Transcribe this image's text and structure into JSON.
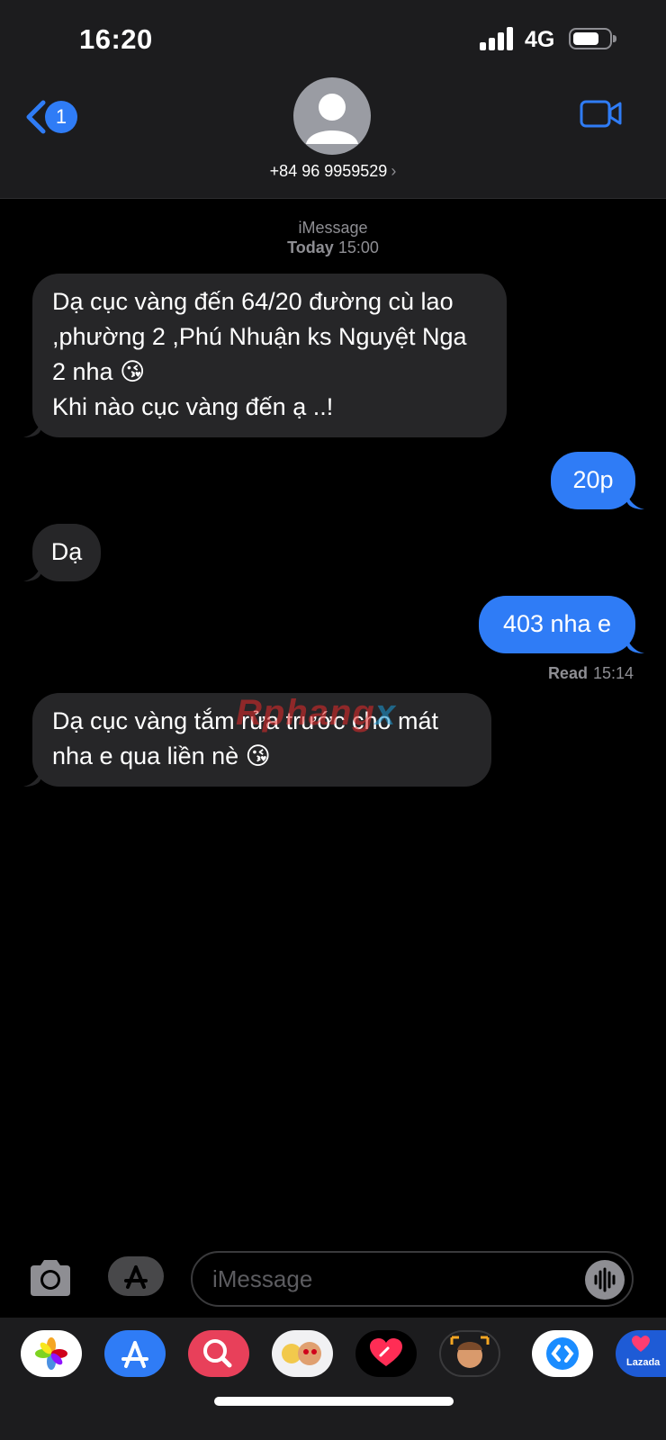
{
  "status_bar": {
    "time": "16:20",
    "network": "4G"
  },
  "header": {
    "unread_count": "1",
    "contact_name": "+84 96 9959529",
    "arrow": "›"
  },
  "conversation": {
    "service": "iMessage",
    "timestamp_label": "Today",
    "timestamp_time": "15:00",
    "messages": [
      {
        "direction": "in",
        "text": "Dạ cục vàng đến 64/20 đường cù lao ,phường 2 ,Phú Nhuận ks Nguyệt Nga 2 nha 😘\nKhi nào cục vàng đến ạ ..!"
      },
      {
        "direction": "out",
        "text": "20p"
      },
      {
        "direction": "in",
        "text": "Dạ"
      },
      {
        "direction": "out",
        "text": "403 nha e"
      },
      {
        "direction": "in",
        "text": "Dạ cục vàng tắm rửa trước cho mát nha e qua liền nè 😘"
      }
    ],
    "read_label": "Read",
    "read_time": "15:14"
  },
  "watermark": {
    "part1": "Rphang",
    "part2": "x"
  },
  "compose": {
    "placeholder": "iMessage"
  },
  "app_drawer": {
    "items": [
      "photos-icon",
      "app-store-icon",
      "search-images-icon",
      "memoji-stickers-icon",
      "digital-touch-icon",
      "memoji-icon",
      "shazam-icon",
      "lazada-icon"
    ],
    "lazada_label": "Lazada"
  }
}
